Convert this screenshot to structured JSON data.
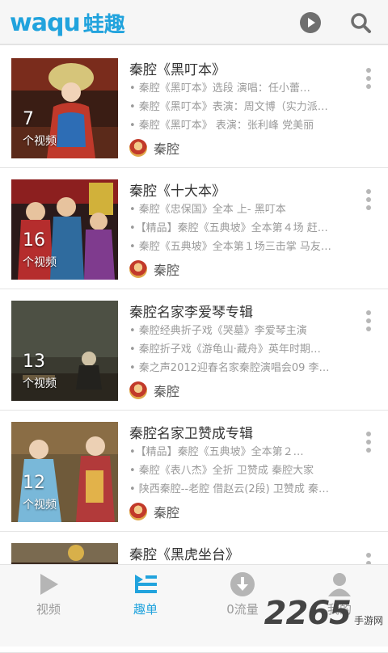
{
  "app": {
    "logo_latin": "waqu",
    "logo_cn": "蛙趣"
  },
  "header_icons": [
    "play-icon",
    "search-icon"
  ],
  "items": [
    {
      "title": "秦腔《黑叮本》",
      "count": "7",
      "unit": "个视频",
      "lines": [
        "• 秦腔《黑叮本》选段 演唱：任小蕾…",
        "• 秦腔《黑叮本》表演：周文博（实力派…",
        "• 秦腔《黑叮本》 表演：张利峰 党美丽"
      ],
      "author": "秦腔"
    },
    {
      "title": "秦腔《十大本》",
      "count": "16",
      "unit": "个视频",
      "lines": [
        "• 秦腔《忠保国》全本 上- 黑叮本",
        "•【精品】秦腔《五典坡》全本第４场 赶…",
        "• 秦腔《五典坡》全本第１场三击掌 马友…"
      ],
      "author": "秦腔"
    },
    {
      "title": "秦腔名家李爱琴专辑",
      "count": "13",
      "unit": "个视频",
      "lines": [
        "• 秦腔经典折子戏《哭墓》李爱琴主演",
        "• 秦腔折子戏《游龟山·藏舟》英年时期…",
        "• 秦之声2012迎春名家秦腔演唱会09 李…"
      ],
      "author": "秦腔"
    },
    {
      "title": "秦腔名家卫赞成专辑",
      "count": "12",
      "unit": "个视频",
      "lines": [
        "•【精品】秦腔《五典坡》全本第２…",
        "• 秦腔《表八杰》全折 卫赞成 秦腔大家",
        "• 陕西秦腔--老腔 借赵云(2段) 卫赞成 秦…"
      ],
      "author": "秦腔"
    },
    {
      "title": "秦腔《黑虎坐台》",
      "count": "",
      "unit": "",
      "lines": [
        "",
        "",
        ""
      ],
      "author": ""
    }
  ],
  "tabs": [
    {
      "label": "视频",
      "icon": "play-triangle-icon",
      "active": false
    },
    {
      "label": "趣单",
      "icon": "playlist-icon",
      "active": true
    },
    {
      "label": "0流量",
      "icon": "download-icon",
      "active": false
    },
    {
      "label": "我的",
      "icon": "user-icon",
      "active": false
    }
  ],
  "watermark": {
    "num": "2265",
    "text": "手游网"
  },
  "colors": {
    "accent": "#21a3dd",
    "inactive": "#9a9a9a"
  }
}
